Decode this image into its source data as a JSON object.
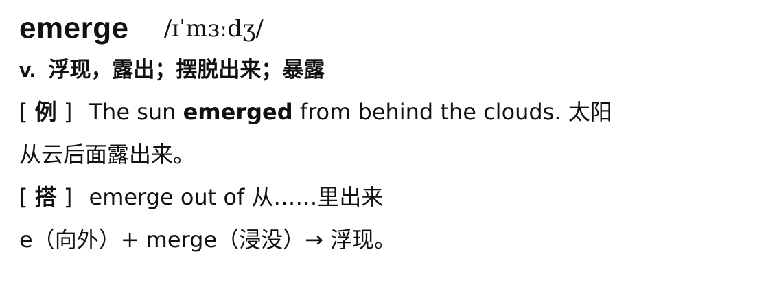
{
  "entry": {
    "headword": "emerge",
    "phonetic": "/ɪˈmɜːdʒ/",
    "definition": {
      "pos": "v.",
      "meaning": "浮现，露出；摆脱出来；暴露"
    },
    "example": {
      "tag_open": "[",
      "tag": "例",
      "tag_close": "]",
      "sentence_before": "The sun ",
      "sentence_keyword": "emerged",
      "sentence_after": " from behind the clouds. 太阳",
      "translation_cont": "从云后面露出来。"
    },
    "collocation": {
      "tag_open": "[",
      "tag": "搭",
      "tag_close": "]",
      "text": "emerge out of 从……里出来"
    },
    "etymology": "e（向外）+ merge（浸没）→ 浮现。"
  }
}
